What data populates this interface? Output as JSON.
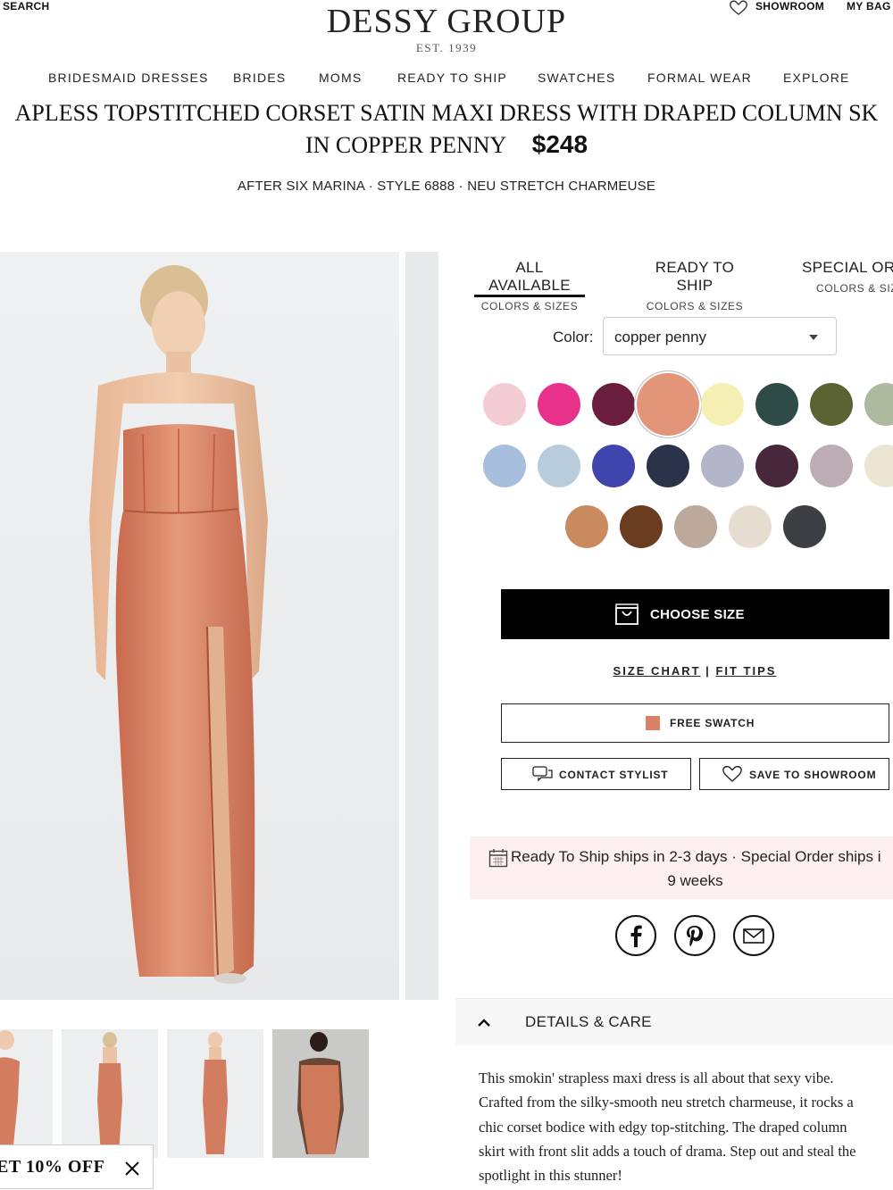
{
  "header": {
    "search_label": "SEARCH",
    "showroom_label": "SHOWROOM",
    "bag_label": "MY BAG",
    "logo": "DESSY GROUP",
    "est": "EST. 1939"
  },
  "nav": {
    "items": [
      "BRIDESMAID DRESSES",
      "BRIDES",
      "MOMS",
      "READY TO SHIP",
      "SWATCHES",
      "FORMAL WEAR",
      "EXPLORE"
    ]
  },
  "product": {
    "title_line1": "APLESS TOPSTITCHED CORSET SATIN MAXI DRESS WITH DRAPED COLUMN SK",
    "title_color": "IN COPPER PENNY",
    "price": "$248",
    "subline": "AFTER SIX MARINA · STYLE 6888 · NEU STRETCH CHARMEUSE"
  },
  "tabs": [
    {
      "title": "ALL AVAILABLE",
      "sub": "COLORS & SIZES",
      "active": true
    },
    {
      "title": "READY TO SHIP",
      "sub": "COLORS & SIZES",
      "active": false
    },
    {
      "title": "SPECIAL ORI",
      "sub": "COLORS & SIZ",
      "active": false
    }
  ],
  "color_select": {
    "label": "Color:",
    "value": "copper penny"
  },
  "swatch_colors": {
    "row1": [
      "#f4cdd4",
      "#e8318a",
      "#6b1d3e",
      "#e3957a",
      "#f6efb4",
      "#2f4b48",
      "#5a6232",
      "#aebaa0"
    ],
    "row2": [
      "#a7bedc",
      "#b8ccdc",
      "#4044ad",
      "#2a3349",
      "#b3b5c8",
      "#48273a",
      "#bcadb5",
      "#ede5d3"
    ],
    "row3": [
      "#c98a5d",
      "#6a3d1f",
      "#bda89c",
      "#e7dcd0",
      "#3d3f45"
    ],
    "selected": "#e3957a"
  },
  "actions": {
    "choose_size": "CHOOSE SIZE",
    "size_chart": "SIZE CHART",
    "separator": "|",
    "fit_tips": "FIT TIPS",
    "free_swatch": "FREE SWATCH",
    "contact_stylist": "CONTACT STYLIST",
    "save_showroom": "SAVE TO SHOWROOM"
  },
  "shipping": {
    "line1": "Ready To Ship ships in 2-3 days · Special Order ships i",
    "line2": "9 weeks"
  },
  "details": {
    "label": "DETAILS & CARE",
    "lines": [
      "This smokin' strapless maxi dress is all about that sexy vibe.",
      "Crafted from the silky-smooth neu stretch charmeuse, it rocks a",
      "chic corset bodice with edgy top-stitching. The draped column",
      "skirt with front slit adds a touch of drama. Step out and steal the",
      "spotlight in this stunner!"
    ]
  },
  "promo": {
    "text": "ET 10% OFF"
  },
  "colors": {
    "dress": "#d98266",
    "accent_black": "#000000",
    "ship_bg": "#fdf0ee"
  }
}
